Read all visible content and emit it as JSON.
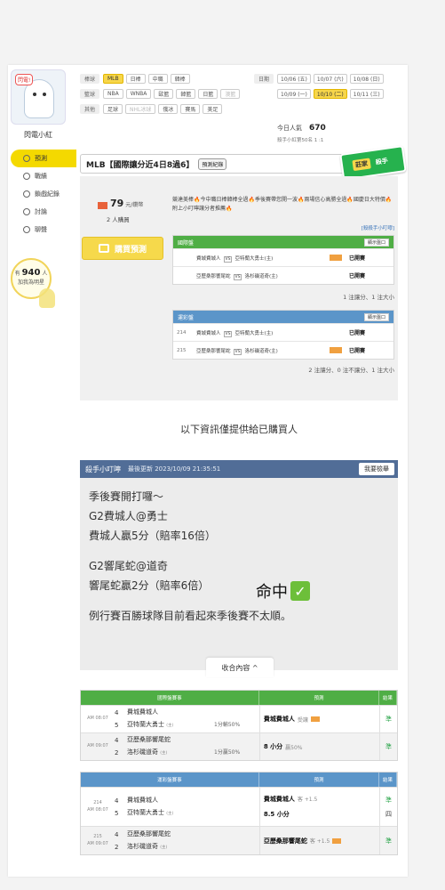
{
  "user": {
    "name": "閃電小紅",
    "avatar_text": "閃電!"
  },
  "nav": [
    {
      "label": "預測",
      "icon": "target-icon"
    },
    {
      "label": "戰績",
      "icon": "chat-icon"
    },
    {
      "label": "鎖戲紀錄",
      "icon": "record-icon"
    },
    {
      "label": "討論",
      "icon": "discuss-icon"
    },
    {
      "label": "聊聲",
      "icon": "mic-icon"
    }
  ],
  "follow": {
    "prefix": "有",
    "count": "940",
    "suffix": "人",
    "line2": "加我為明星"
  },
  "filters": [
    {
      "label": "棒球",
      "chips": [
        "MLB",
        "日棒",
        "中職",
        "韓棒"
      ]
    },
    {
      "label": "籃球",
      "chips": [
        "NBA",
        "WNBA",
        "歐籃",
        "韓籃",
        "日籃",
        "澳籃"
      ]
    },
    {
      "label": "其他",
      "chips": [
        "足球",
        "NHL冰球",
        "俄冰",
        "賽馬",
        "美足"
      ]
    }
  ],
  "dates": {
    "label": "日期",
    "chips": [
      "10/06 (五)",
      "10/07 (六)",
      "10/08 (日)",
      "10/09 (一)",
      "10/10 (二)",
      "10/11 (三)"
    ]
  },
  "stats": {
    "visitors_label": "今日人氣",
    "visitors": "670",
    "rank": "殺手小紅第50名 1 :1"
  },
  "title": {
    "text": "MLB【國際讓分近4日8過6】",
    "tag": "預測紀錄"
  },
  "badge": {
    "a": "莊家",
    "b": "殺手"
  },
  "offer": {
    "price": "79",
    "price_unit": "元/鑽幣",
    "buyers": "2 人購買",
    "buy_button": "購買預測"
  },
  "desc": "競達美棒🔥今中職日棒韓棒全過🔥季後賽帶您開一波🔥兩場信心高勝全過🔥國慶日大特價🔥附上小叮嚀讓分者推薦🔥",
  "link": "[殺殺手小叮嚀]",
  "intl_table": {
    "title": "國際盤",
    "open": "顯示盤口",
    "rows": [
      {
        "num": "",
        "home": "費城費城人",
        "away": "亞特蘭大勇士(主)",
        "res": "已開賽"
      },
      {
        "num": "",
        "home": "亞歷桑那響尾蛇",
        "away": "洛杉磯道奇(主)",
        "res": "已開賽"
      }
    ],
    "summary": "1 注讓分、1 注大小"
  },
  "lottery_table": {
    "title": "運彩盤",
    "open": "顯示盤口",
    "rows": [
      {
        "num": "214",
        "home": "費城費城人",
        "away": "亞特蘭大勇士(主)",
        "res": "已開賽"
      },
      {
        "num": "215",
        "home": "亞歷桑那響尾蛇",
        "away": "洛杉磯道奇(主)",
        "res": "已開賽"
      }
    ],
    "summary": "2 注讓分、0 注不讓分、1 注大小"
  },
  "notice": "以下資訊僅提供給已購買人",
  "note": {
    "title": "殺手小叮嚀",
    "updated": "最後更新 2023/10/09 21:35:51",
    "report": "我要檢舉",
    "lines": [
      "季後賽開打囉～",
      "G2費城人@勇士",
      "費城人贏5分（賠率16倍）",
      "",
      "G2響尾蛇@道奇",
      "響尾蛇贏2分（賠率6倍）",
      "",
      "例行賽百勝球隊目前看起來季後賽不太順。"
    ],
    "hit": "命中",
    "collapse": "收合內容 ^"
  },
  "bottom_intl": {
    "headers": [
      "國際盤賽事",
      "預測",
      "結果"
    ],
    "color": "#4fae45",
    "rows": [
      {
        "time": "AM 08:07",
        "n1": "4",
        "t1": "費城費城人",
        "n2": "5",
        "t2": "亞特蘭大勇士",
        "line": "1分輸50%",
        "pick": "費城費城人",
        "pick_note": "受讓",
        "result": "準"
      },
      {
        "time": "AM 09:07",
        "n1": "4",
        "t1": "亞歷桑那響尾蛇",
        "n2": "2",
        "t2": "洛杉磯道奇",
        "line": "1分贏50%",
        "pick": "8 小分",
        "pick_note": "贏50%",
        "result": "準"
      }
    ]
  },
  "bottom_lottery": {
    "headers": [
      "運彩盤賽事",
      "預測",
      "結果"
    ],
    "color": "#5b95c9",
    "rows": [
      {
        "time": "214",
        "time2": "AM 08:07",
        "n1": "4",
        "t1": "費城費城人",
        "n2": "5",
        "t2": "亞特蘭大勇士",
        "pick": "費城費城人",
        "pick_note": "客 +1.5",
        "pick2": "8.5 小分",
        "result": "準",
        "result2": "四"
      },
      {
        "time": "215",
        "time2": "AM 09:07",
        "n1": "4",
        "t1": "亞歷桑那響尾蛇",
        "n2": "2",
        "t2": "洛杉磯道奇",
        "pick": "亞歷桑那響尾蛇",
        "pick_note": "客 +1.5",
        "result": "準"
      }
    ]
  },
  "colors": {
    "accent": "#f7d64a",
    "intl_head": "#4fae45",
    "lottery_head": "#5b95c9",
    "note_head": "#516d97"
  }
}
